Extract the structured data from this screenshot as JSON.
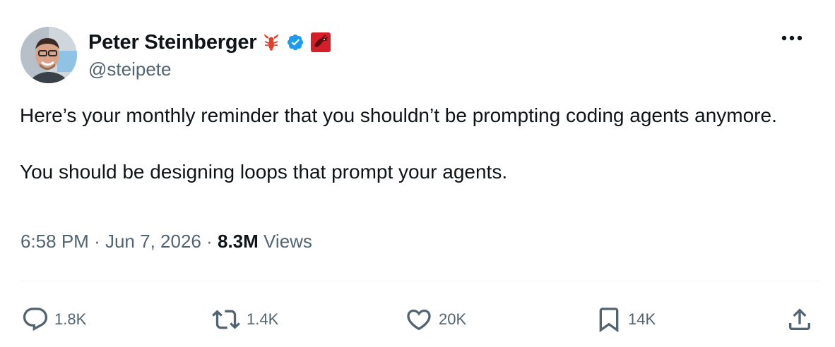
{
  "author": {
    "name": "Peter Steinberger",
    "handle": "@steipete",
    "badges": [
      "lobster-emoji",
      "verified-badge",
      "red-lobster-badge"
    ],
    "verified_color": "#1d9bf0"
  },
  "tweet": {
    "paragraphs": [
      "Here’s your monthly reminder that you shouldn’t be prompting coding agents anymore.",
      "You should be designing loops that prompt your agents."
    ],
    "time": "6:58 PM",
    "date": "Jun 7, 2026",
    "separator": "·",
    "views_count": "8.3M",
    "views_label": "Views"
  },
  "actions": {
    "replies": "1.8K",
    "reposts": "1.4K",
    "likes": "20K",
    "bookmarks": "14K"
  },
  "icons": {
    "more": "more-dots-icon",
    "reply": "reply-bubble-icon",
    "repost": "repost-arrows-icon",
    "like": "heart-icon",
    "bookmark": "bookmark-icon",
    "share": "share-upload-icon"
  },
  "colors": {
    "text": "#0f1419",
    "secondary": "#536471",
    "divider": "#eff3f4"
  }
}
